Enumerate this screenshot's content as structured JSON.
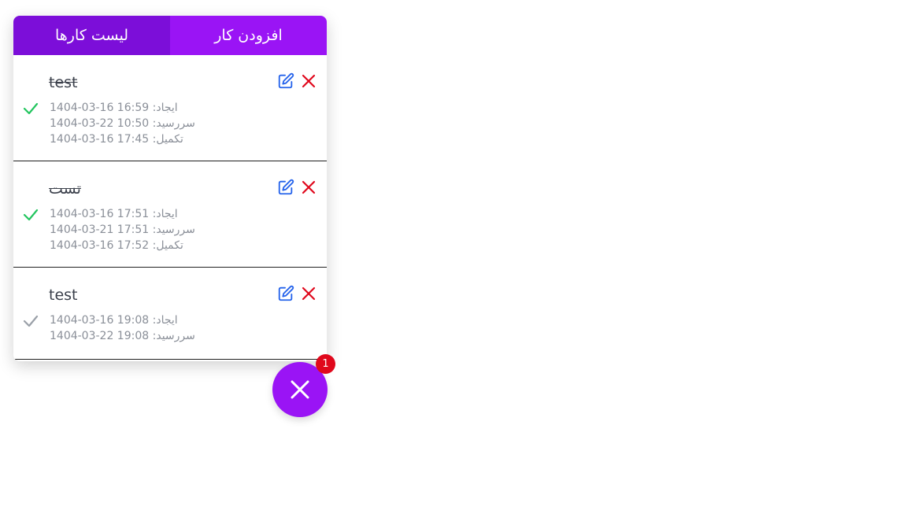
{
  "tabs": {
    "list_label": "لیست کارها",
    "add_label": "افزودن کار"
  },
  "tasks": [
    {
      "title": "test",
      "completed": true,
      "created_label": "ایجاد:",
      "created": "1404-03-16 16:59",
      "due_label": "سررسید:",
      "due": "1404-03-22 10:50",
      "done_label": "تکمیل:",
      "done": "1404-03-16 17:45"
    },
    {
      "title": "تست",
      "completed": true,
      "created_label": "ایجاد:",
      "created": "1404-03-16 17:51",
      "due_label": "سررسید:",
      "due": "1404-03-21 17:51",
      "done_label": "تکمیل:",
      "done": "1404-03-16 17:52"
    },
    {
      "title": "test",
      "completed": false,
      "created_label": "ایجاد:",
      "created": "1404-03-16 19:08",
      "due_label": "سررسید:",
      "due": "1404-03-22 19:08"
    }
  ],
  "fab": {
    "icon": "close-icon",
    "badge_count": "1"
  },
  "colors": {
    "tab_active": "#7c0ed9",
    "tab_inactive": "#9a14f5",
    "check_done": "#22c55e",
    "check_pending": "#9aa0a8",
    "edit": "#2563eb",
    "delete": "#e0081c",
    "badge": "#e0081c"
  }
}
